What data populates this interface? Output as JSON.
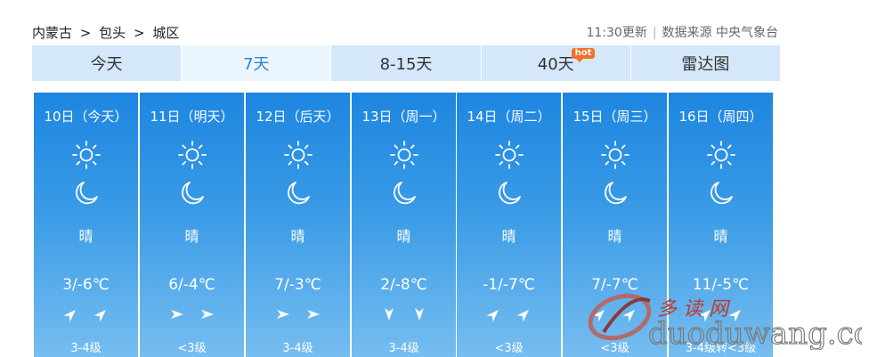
{
  "breadcrumb": {
    "province": "内蒙古",
    "city": "包头",
    "district": "城区",
    "sep": ">"
  },
  "meta": {
    "updated": "11:30更新",
    "source": "数据来源 中央气象台"
  },
  "tabs": [
    {
      "label": "今天",
      "active": false
    },
    {
      "label": "7天",
      "active": true
    },
    {
      "label": "8-15天",
      "active": false
    },
    {
      "label": "40天",
      "active": false,
      "badge": "hot"
    },
    {
      "label": "雷达图",
      "active": false
    }
  ],
  "forecast": [
    {
      "date": "10日（今天）",
      "day_icon": "sun-icon",
      "night_icon": "moon-icon",
      "condition": "晴",
      "temp": "3/-6℃",
      "wind_dir": "northeast",
      "wind_level": "3-4级"
    },
    {
      "date": "11日（明天）",
      "day_icon": "sun-icon",
      "night_icon": "moon-icon",
      "condition": "晴",
      "temp": "6/-4℃",
      "wind_dir": "east",
      "wind_level": "<3级"
    },
    {
      "date": "12日（后天）",
      "day_icon": "sun-icon",
      "night_icon": "moon-icon",
      "condition": "晴",
      "temp": "7/-3℃",
      "wind_dir": "east",
      "wind_level": "3-4级"
    },
    {
      "date": "13日（周一）",
      "day_icon": "sun-icon",
      "night_icon": "moon-icon",
      "condition": "晴",
      "temp": "2/-8℃",
      "wind_dir": "south",
      "wind_level": "3-4级"
    },
    {
      "date": "14日（周二）",
      "day_icon": "sun-icon",
      "night_icon": "moon-icon",
      "condition": "晴",
      "temp": "-1/-7℃",
      "wind_dir": "northeast",
      "wind_level": "<3级"
    },
    {
      "date": "15日（周三）",
      "day_icon": "sun-icon",
      "night_icon": "moon-icon",
      "condition": "晴",
      "temp": "7/-7℃",
      "wind_dir": "northeast",
      "wind_level": "<3级"
    },
    {
      "date": "16日（周四）",
      "day_icon": "sun-icon",
      "night_icon": "moon-icon",
      "condition": "晴",
      "temp": "11/-5℃",
      "wind_dir": "northeast",
      "wind_level": "3-4级转<3级"
    }
  ],
  "watermark": {
    "cn": "多 读 网",
    "en": "duoduwang.com"
  },
  "colors": {
    "card_top": "#1d86e0",
    "card_bottom": "#76bdf0",
    "tab_bg": "#d4e8fa",
    "tab_active_text": "#2d86d6",
    "hot": "#f4702a"
  }
}
